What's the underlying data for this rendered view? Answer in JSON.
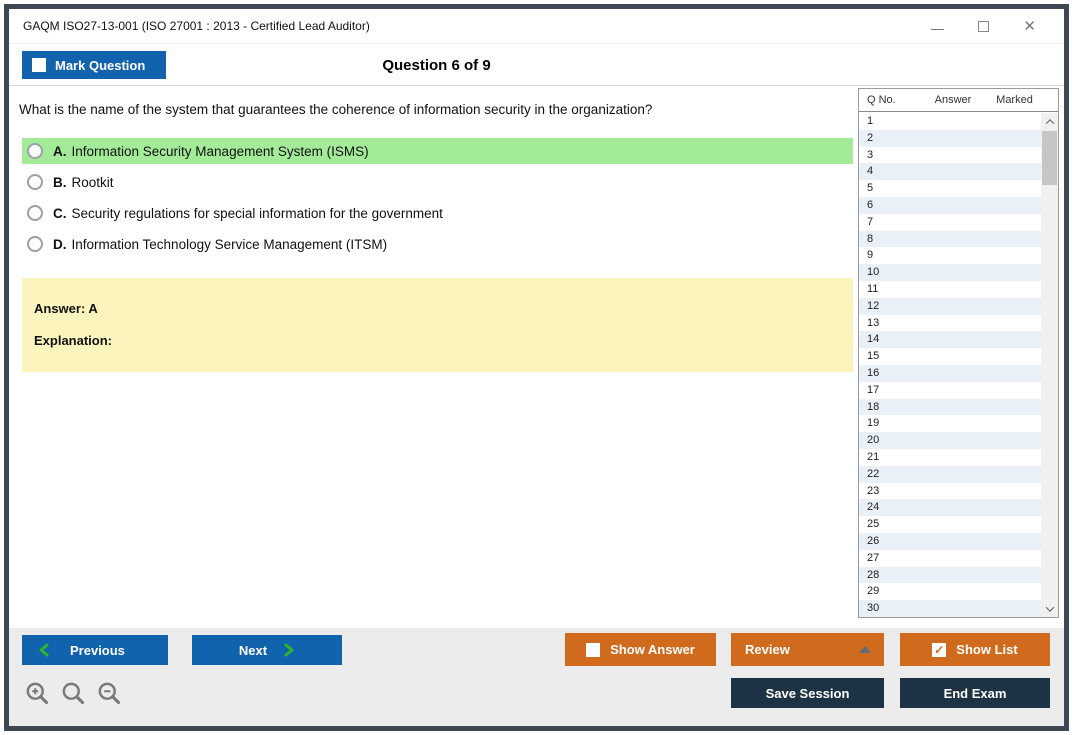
{
  "window": {
    "title": "GAQM ISO27-13-001 (ISO 27001 : 2013 - Certified Lead Auditor)"
  },
  "header": {
    "mark_question_label": "Mark Question",
    "question_counter": "Question 6 of 9"
  },
  "question": {
    "text": "What is the name of the system that guarantees the coherence of information security in the organization?",
    "options": [
      {
        "letter": "A.",
        "text": "Information Security Management System (ISMS)",
        "highlighted": true
      },
      {
        "letter": "B.",
        "text": "Rootkit",
        "highlighted": false
      },
      {
        "letter": "C.",
        "text": "Security regulations for special information for the government",
        "highlighted": false
      },
      {
        "letter": "D.",
        "text": "Information Technology Service Management (ITSM)",
        "highlighted": false
      }
    ],
    "answer_label": "Answer: A",
    "explanation_label": "Explanation:"
  },
  "sidebar": {
    "columns": [
      "Q No.",
      "Answer",
      "Marked"
    ],
    "q_numbers": [
      1,
      2,
      3,
      4,
      5,
      6,
      7,
      8,
      9,
      10,
      11,
      12,
      13,
      14,
      15,
      16,
      17,
      18,
      19,
      20,
      21,
      22,
      23,
      24,
      25,
      26,
      27,
      28,
      29,
      30
    ]
  },
  "footer": {
    "previous_label": "Previous",
    "next_label": "Next",
    "show_answer_label": "Show Answer",
    "review_label": "Review",
    "show_list_label": "Show List",
    "save_session_label": "Save Session",
    "end_exam_label": "End Exam",
    "show_answer_checked": false,
    "show_list_checked": true,
    "mark_question_checked": false
  },
  "icons": {
    "close": "✕",
    "maximize": "□",
    "minimize": "—",
    "review_dropdown": "▲",
    "show_list_check": "✓",
    "zoom_in": "+",
    "zoom_out": "−"
  },
  "colors": {
    "accent_blue": "#1163ae",
    "accent_orange": "#d06a1c",
    "dark_navy": "#1d3345",
    "highlight_green": "#a4eb99",
    "answer_yellow": "#fbf4bd",
    "alt_row_blue": "#e9f0f8",
    "chevron_green": "#2db52d",
    "window_frame": "#3d4854"
  }
}
